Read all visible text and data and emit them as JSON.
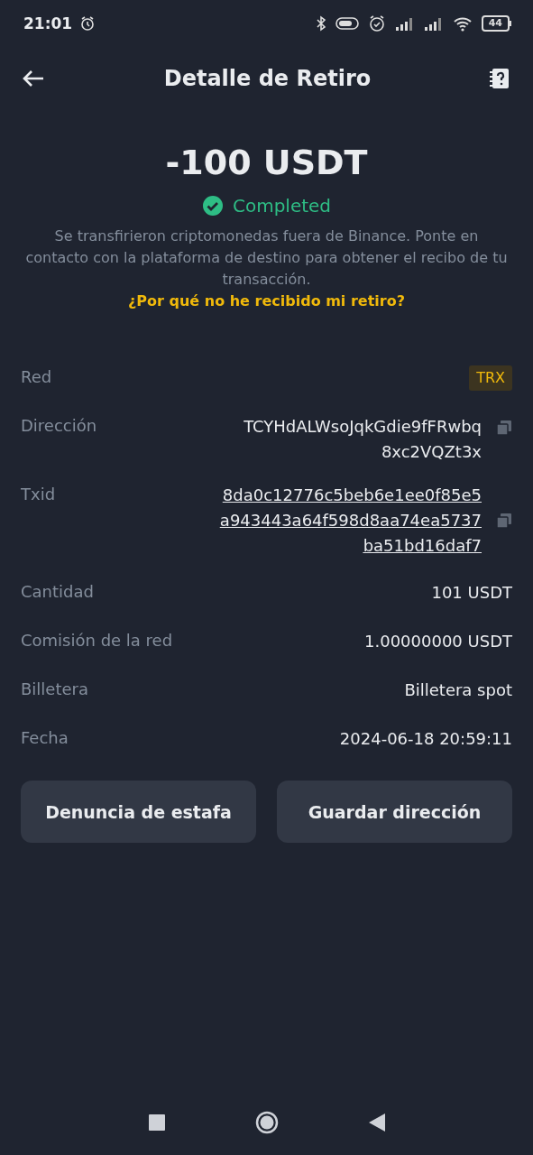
{
  "status_bar": {
    "time": "21:01",
    "battery": "44"
  },
  "header": {
    "title": "Detalle de Retiro"
  },
  "summary": {
    "amount": "-100 USDT",
    "status": {
      "text": "Completed",
      "kind": "success"
    },
    "message": "Se transfirieron criptomonedas fuera de Binance. Ponte en contacto con la plataforma de destino para obtener el recibo de tu transacción.",
    "help_link": "¿Por qué no he recibido mi retiro?"
  },
  "details": [
    {
      "kind": "badge",
      "label": "Red",
      "lines": [
        "TRX"
      ]
    },
    {
      "kind": "copy",
      "label": "Dirección",
      "lines": [
        "TCYHdALWsoJqkGdie9fFRwbq",
        "8xc2VQZt3x"
      ]
    },
    {
      "kind": "link-copy",
      "label": "Txid",
      "lines": [
        "8da0c12776c5beb6e1ee0f85e5",
        "a943443a64f598d8aa74ea5737",
        "ba51bd16daf7"
      ]
    },
    {
      "kind": "text",
      "label": "Cantidad",
      "lines": [
        "101 USDT"
      ]
    },
    {
      "kind": "text",
      "label": "Comisión de la red",
      "lines": [
        "1.00000000 USDT"
      ]
    },
    {
      "kind": "text",
      "label": "Billetera",
      "lines": [
        "Billetera spot"
      ]
    },
    {
      "kind": "text",
      "label": "Fecha",
      "lines": [
        "2024-06-18 20:59:11"
      ]
    }
  ],
  "buttons": [
    "Denuncia de estafa",
    "Guardar dirección"
  ]
}
